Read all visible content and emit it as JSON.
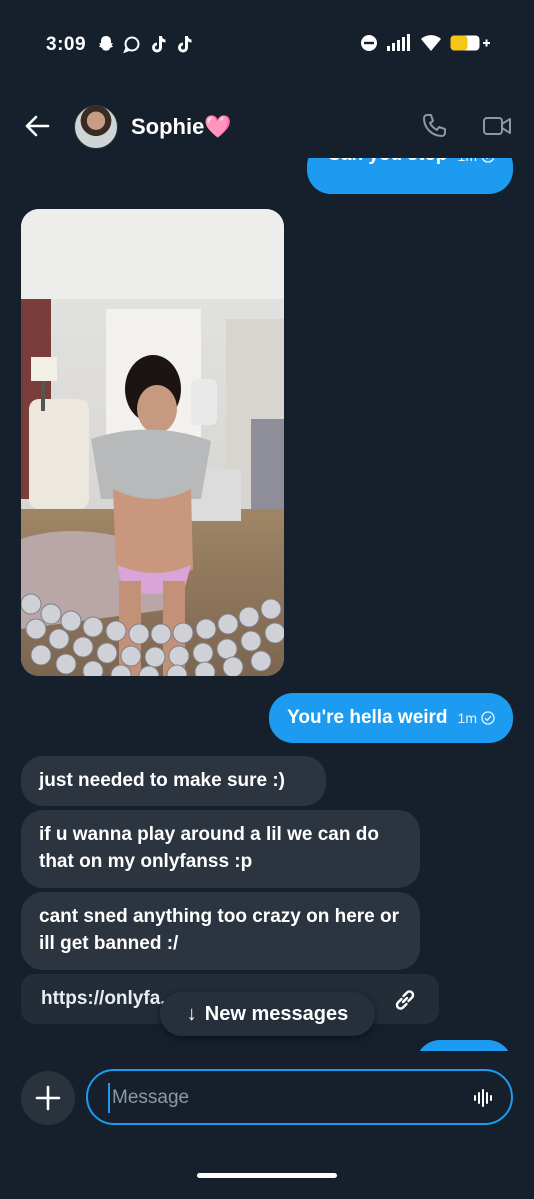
{
  "status_bar": {
    "time": "3:09",
    "left_icons": [
      "snapchat-icon",
      "chat-bubble-icon",
      "tiktok-icon",
      "tiktok-icon"
    ],
    "right_icons": [
      "do-not-disturb-icon",
      "signal-icon",
      "wifi-icon",
      "battery-charging-icon"
    ],
    "battery_color": "#f5c518"
  },
  "header": {
    "contact_name": "Sophie🩷"
  },
  "messages": {
    "sent_1": {
      "text": "Can you stop",
      "time": "1m"
    },
    "sent_2": {
      "text": "You're hella weird",
      "time": "1m"
    },
    "received": [
      {
        "text": "just needed to make sure :)"
      },
      {
        "text": "if u wanna play around a lil we can do that on my onlyfanss :p"
      },
      {
        "text": "cant sned anything too crazy on here or ill get banned :/"
      }
    ],
    "link_text": "https://onlyfa... ..."
  },
  "new_messages": {
    "label": "New messages",
    "arrow": "↓"
  },
  "composer": {
    "placeholder": "Message"
  },
  "colors": {
    "background": "#16202c",
    "accent": "#1d9bf0",
    "received_bubble": "#2c3440"
  }
}
